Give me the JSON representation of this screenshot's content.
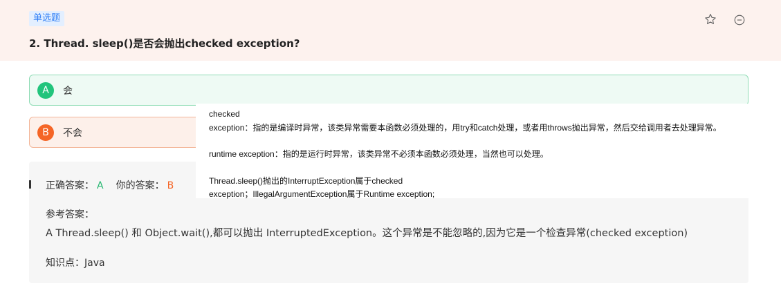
{
  "question": {
    "type_badge": "单选题",
    "title": "2. Thread. sleep()是否会抛出checked exception?"
  },
  "icons": {
    "favorite": "star-outline-icon",
    "collapse": "minus-circle-icon"
  },
  "options": [
    {
      "letter": "A",
      "text": "会"
    },
    {
      "letter": "B",
      "text": "不会"
    }
  ],
  "result": {
    "correct_label": "正确答案：",
    "correct_value": "A",
    "yours_label": "你的答案：",
    "yours_value": "B"
  },
  "reference": {
    "label": "参考答案：",
    "text": "A Thread.sleep() 和 Object.wait(),都可以抛出 InterruptedException。这个异常是不能忽略的,因为它是一个检查异常(checked exception)",
    "knowledge": "知识点：Java"
  },
  "tooltip": {
    "line1": "checked",
    "line2": "exception：指的是编译时异常，该类异常需要本函数必须处理的，用try和catch处理，或者用throws抛出异常，然后交给调用者去处理异常。",
    "line3": "runtime exception：指的是运行时异常，该类异常不必须本函数必须处理，当然也可以处理。",
    "line4": "Thread.sleep()抛出的InterruptException属于checked",
    "line5": "exception；IllegalArgumentException属于Runtime exception;"
  },
  "colors": {
    "header_bg": "#fdf2ee",
    "badge_text": "#2f7ef5",
    "correct": "#22c47c",
    "wrong": "#f56526"
  }
}
